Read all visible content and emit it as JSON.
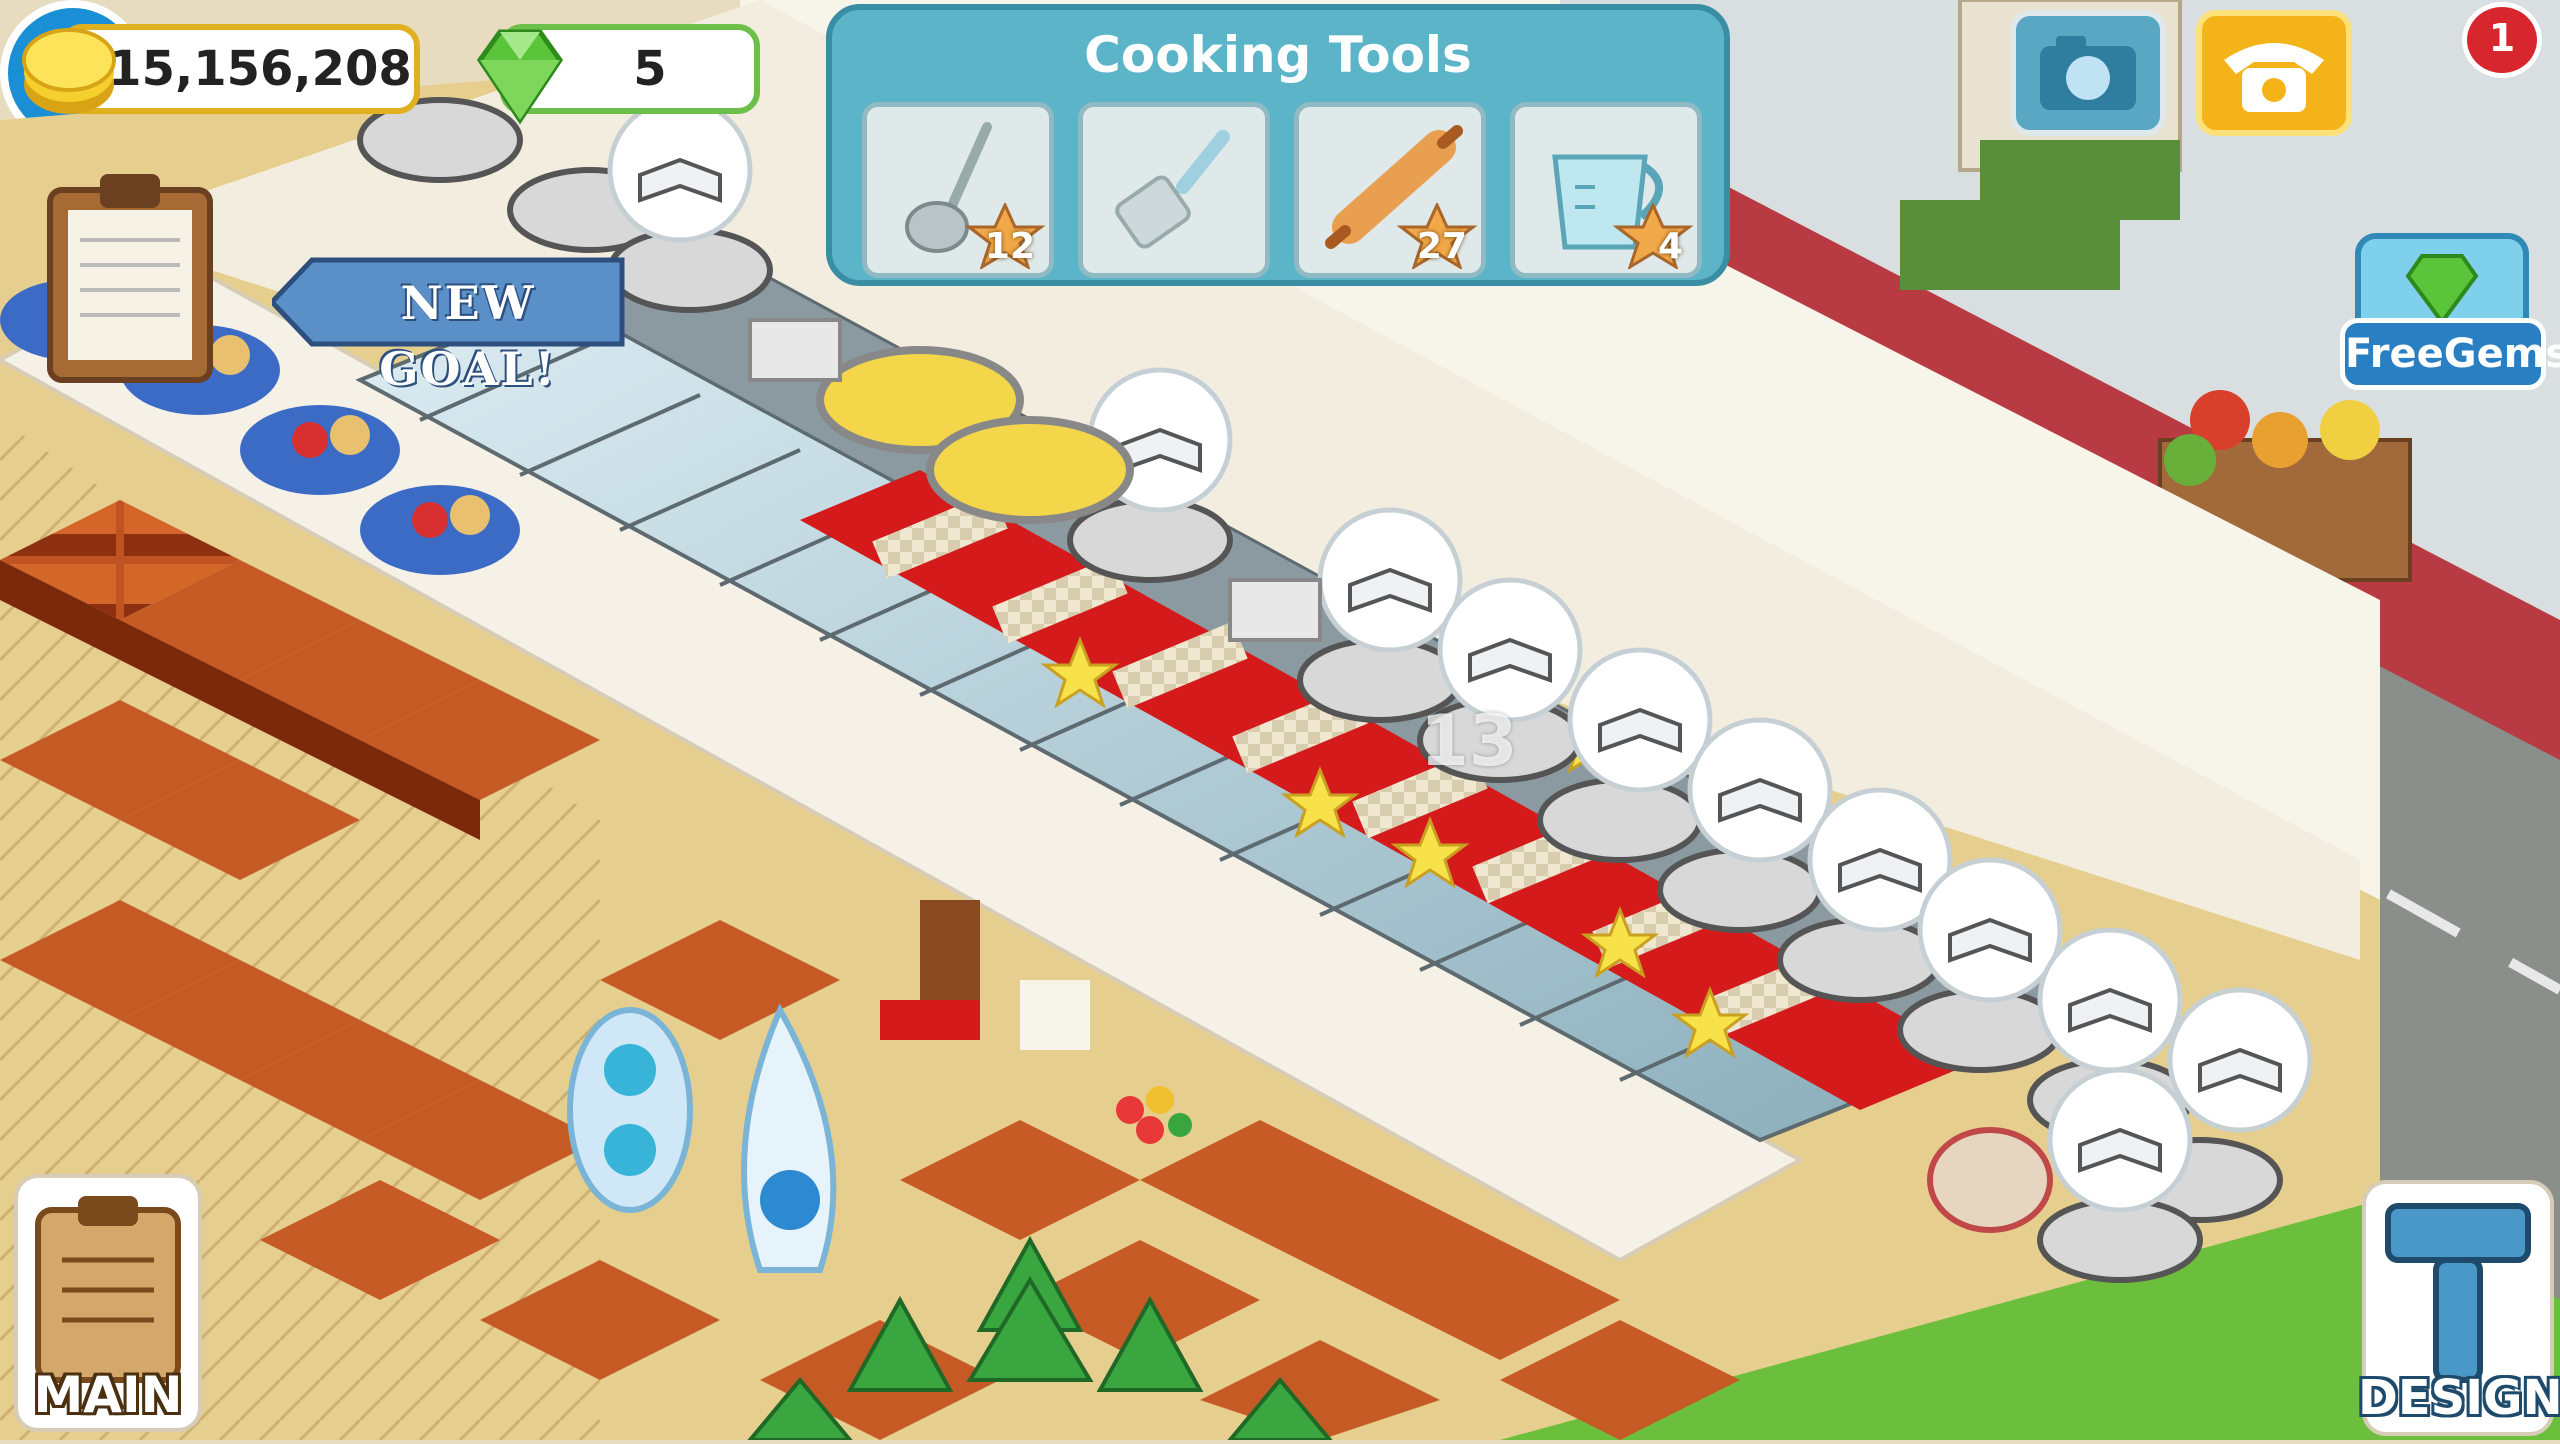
{
  "hud": {
    "coins": "15,156,208",
    "gems": "5"
  },
  "cooking_tools": {
    "title": "Cooking Tools",
    "tools": [
      {
        "icon": "ladle-icon",
        "count": "12"
      },
      {
        "icon": "spatula-icon",
        "count": ""
      },
      {
        "icon": "rolling-pin-icon",
        "count": "27"
      },
      {
        "icon": "measuring-cup-icon",
        "count": "4"
      }
    ]
  },
  "buttons": {
    "new_goal": "NEW GOAL!",
    "free_gems": "FreeGems",
    "main": "MAIN",
    "design": "DESIGN",
    "social_badge": "1"
  },
  "floating_text": "13",
  "colors": {
    "floor_wood": "#b8451c",
    "counter_white": "#f6f1e6",
    "carpet_red": "#d41a1a",
    "panel_blue": "#5bb4c8",
    "coin_gold": "#f0c419",
    "gem_green": "#5ac43a",
    "road_gray": "#8a8f8c"
  }
}
